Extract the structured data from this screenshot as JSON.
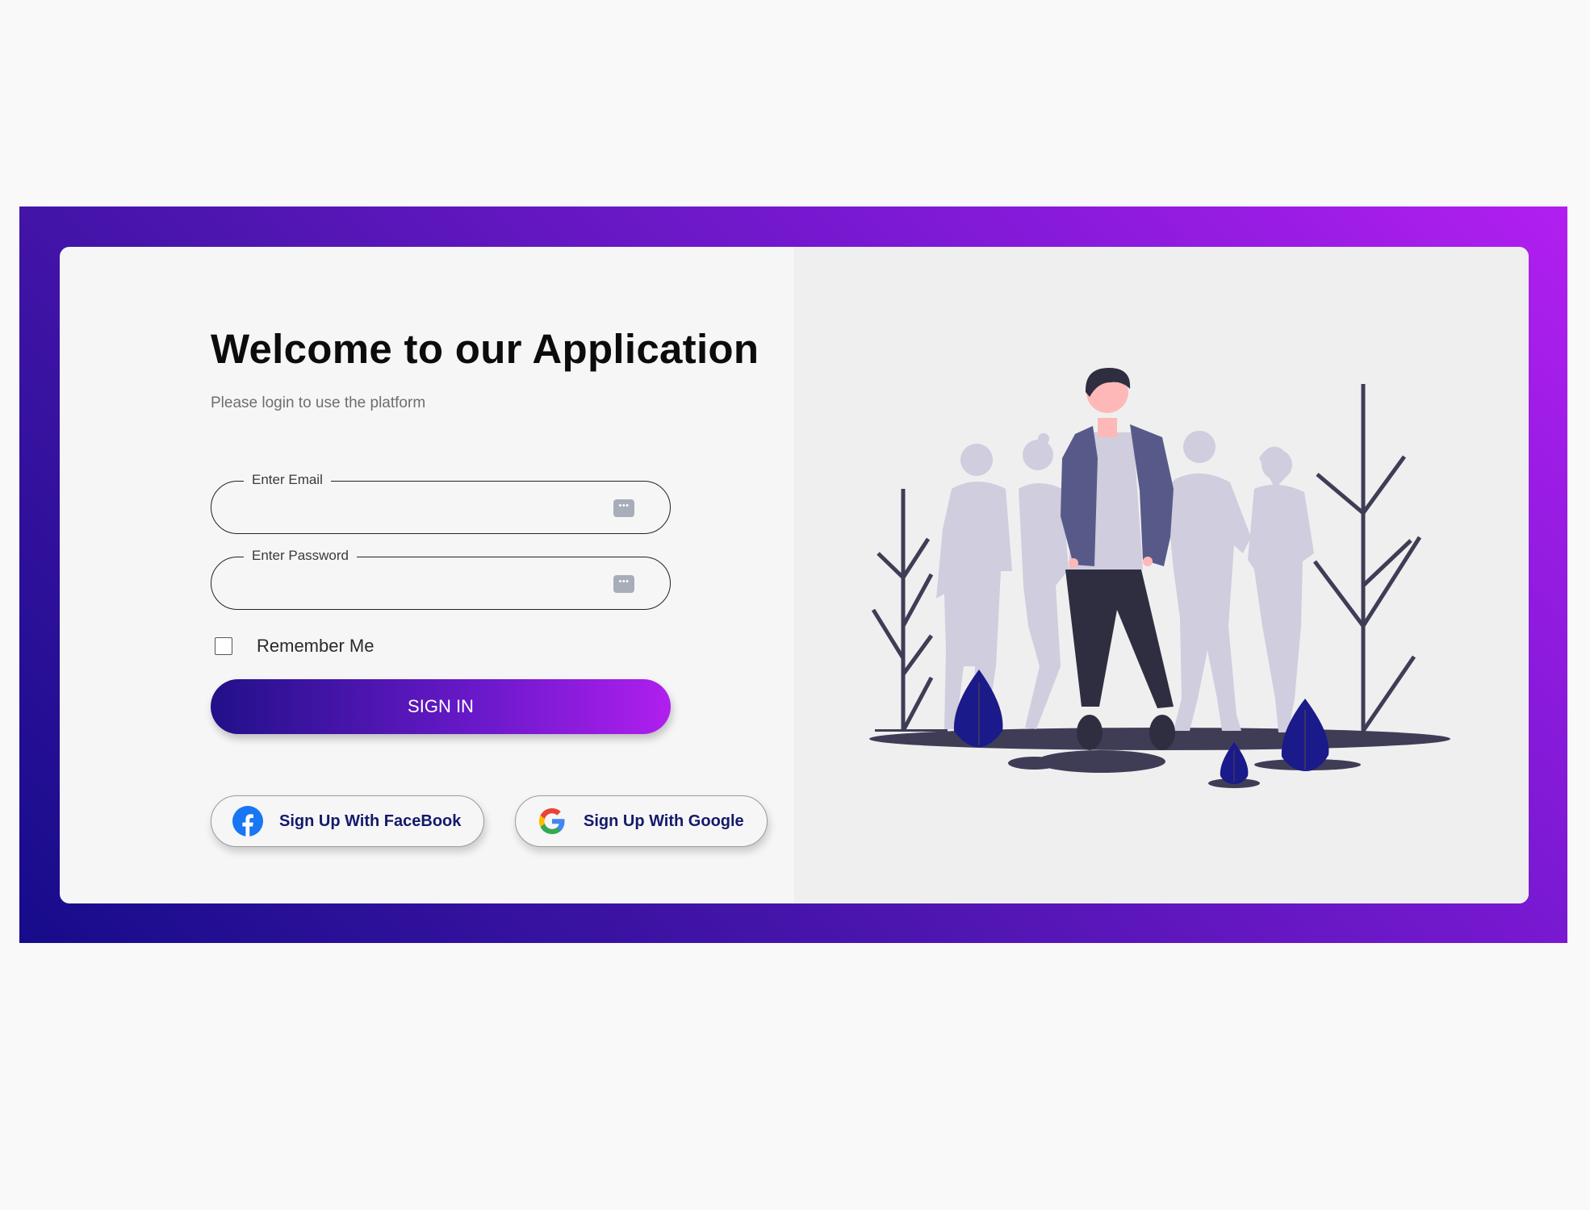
{
  "header": {
    "title": "Welcome to our Application",
    "subtitle": "Please login to use the platform"
  },
  "form": {
    "email": {
      "label": "Enter Email",
      "value": "",
      "icon": "password-manager-icon"
    },
    "password": {
      "label": "Enter Password",
      "value": "",
      "icon": "password-manager-icon"
    },
    "remember": {
      "label": "Remember Me",
      "checked": false
    },
    "signin_label": "SIGN IN"
  },
  "social": {
    "facebook_label": "Sign Up With FaceBook",
    "google_label": "Sign Up With Google"
  },
  "colors": {
    "gradient_start": "#160c8a",
    "gradient_end": "#b21ff0",
    "card_background": "#f6f6f6",
    "illustration_background": "#efefef",
    "social_text": "#14196b",
    "facebook_blue": "#1877f2"
  },
  "illustration": {
    "name": "people-standing-illustration"
  }
}
